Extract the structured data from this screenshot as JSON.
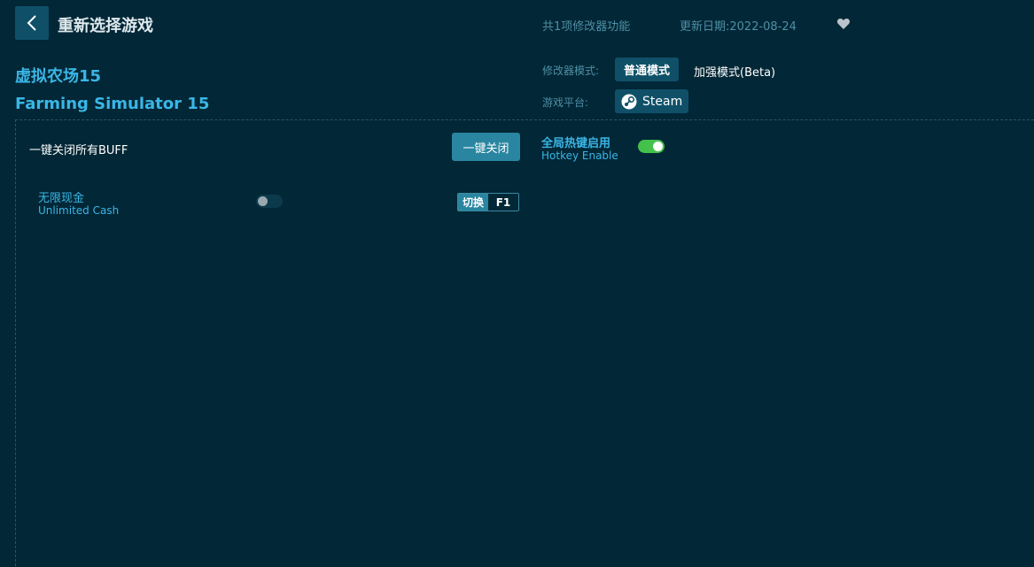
{
  "header": {
    "back_title": "重新选择游戏",
    "feature_count": "共1项修改器功能",
    "update_date": "更新日期:2022-08-24"
  },
  "game": {
    "name_cn": "虚拟农场15",
    "name_en": "Farming Simulator 15"
  },
  "mode": {
    "label": "修改器模式:",
    "normal": "普通模式",
    "enhanced": "加强模式(Beta)",
    "selected": "普通模式"
  },
  "platform": {
    "label": "游戏平台:",
    "name": "Steam"
  },
  "controls": {
    "close_all_label": "一键关闭所有BUFF",
    "close_all_button": "一键关闭",
    "hotkey_cn": "全局热键启用",
    "hotkey_en": "Hotkey Enable",
    "hotkey_enabled": true
  },
  "cheats": [
    {
      "name_cn": "无限现金",
      "name_en": "Unlimited Cash",
      "enabled": false,
      "action": "切换",
      "key": "F1"
    }
  ],
  "colors": {
    "background": "#022736",
    "accent": "#3ab6e6",
    "button": "#0f5068",
    "toggle_on": "#43c14a"
  },
  "icons": [
    "back-arrow-icon",
    "heart-icon",
    "steam-icon"
  ]
}
